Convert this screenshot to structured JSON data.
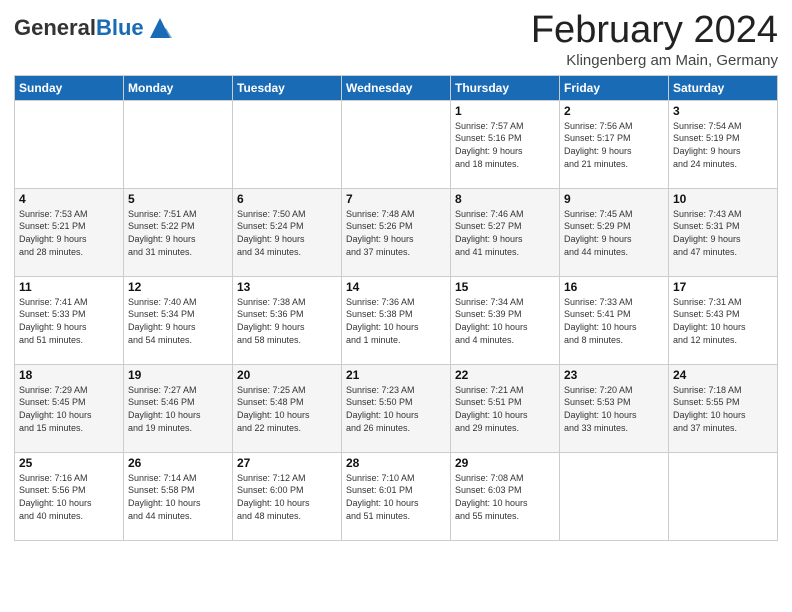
{
  "header": {
    "logo_general": "General",
    "logo_blue": "Blue",
    "title": "February 2024",
    "subtitle": "Klingenberg am Main, Germany"
  },
  "days_of_week": [
    "Sunday",
    "Monday",
    "Tuesday",
    "Wednesday",
    "Thursday",
    "Friday",
    "Saturday"
  ],
  "weeks": [
    [
      {
        "day": "",
        "info": ""
      },
      {
        "day": "",
        "info": ""
      },
      {
        "day": "",
        "info": ""
      },
      {
        "day": "",
        "info": ""
      },
      {
        "day": "1",
        "info": "Sunrise: 7:57 AM\nSunset: 5:16 PM\nDaylight: 9 hours\nand 18 minutes."
      },
      {
        "day": "2",
        "info": "Sunrise: 7:56 AM\nSunset: 5:17 PM\nDaylight: 9 hours\nand 21 minutes."
      },
      {
        "day": "3",
        "info": "Sunrise: 7:54 AM\nSunset: 5:19 PM\nDaylight: 9 hours\nand 24 minutes."
      }
    ],
    [
      {
        "day": "4",
        "info": "Sunrise: 7:53 AM\nSunset: 5:21 PM\nDaylight: 9 hours\nand 28 minutes."
      },
      {
        "day": "5",
        "info": "Sunrise: 7:51 AM\nSunset: 5:22 PM\nDaylight: 9 hours\nand 31 minutes."
      },
      {
        "day": "6",
        "info": "Sunrise: 7:50 AM\nSunset: 5:24 PM\nDaylight: 9 hours\nand 34 minutes."
      },
      {
        "day": "7",
        "info": "Sunrise: 7:48 AM\nSunset: 5:26 PM\nDaylight: 9 hours\nand 37 minutes."
      },
      {
        "day": "8",
        "info": "Sunrise: 7:46 AM\nSunset: 5:27 PM\nDaylight: 9 hours\nand 41 minutes."
      },
      {
        "day": "9",
        "info": "Sunrise: 7:45 AM\nSunset: 5:29 PM\nDaylight: 9 hours\nand 44 minutes."
      },
      {
        "day": "10",
        "info": "Sunrise: 7:43 AM\nSunset: 5:31 PM\nDaylight: 9 hours\nand 47 minutes."
      }
    ],
    [
      {
        "day": "11",
        "info": "Sunrise: 7:41 AM\nSunset: 5:33 PM\nDaylight: 9 hours\nand 51 minutes."
      },
      {
        "day": "12",
        "info": "Sunrise: 7:40 AM\nSunset: 5:34 PM\nDaylight: 9 hours\nand 54 minutes."
      },
      {
        "day": "13",
        "info": "Sunrise: 7:38 AM\nSunset: 5:36 PM\nDaylight: 9 hours\nand 58 minutes."
      },
      {
        "day": "14",
        "info": "Sunrise: 7:36 AM\nSunset: 5:38 PM\nDaylight: 10 hours\nand 1 minute."
      },
      {
        "day": "15",
        "info": "Sunrise: 7:34 AM\nSunset: 5:39 PM\nDaylight: 10 hours\nand 4 minutes."
      },
      {
        "day": "16",
        "info": "Sunrise: 7:33 AM\nSunset: 5:41 PM\nDaylight: 10 hours\nand 8 minutes."
      },
      {
        "day": "17",
        "info": "Sunrise: 7:31 AM\nSunset: 5:43 PM\nDaylight: 10 hours\nand 12 minutes."
      }
    ],
    [
      {
        "day": "18",
        "info": "Sunrise: 7:29 AM\nSunset: 5:45 PM\nDaylight: 10 hours\nand 15 minutes."
      },
      {
        "day": "19",
        "info": "Sunrise: 7:27 AM\nSunset: 5:46 PM\nDaylight: 10 hours\nand 19 minutes."
      },
      {
        "day": "20",
        "info": "Sunrise: 7:25 AM\nSunset: 5:48 PM\nDaylight: 10 hours\nand 22 minutes."
      },
      {
        "day": "21",
        "info": "Sunrise: 7:23 AM\nSunset: 5:50 PM\nDaylight: 10 hours\nand 26 minutes."
      },
      {
        "day": "22",
        "info": "Sunrise: 7:21 AM\nSunset: 5:51 PM\nDaylight: 10 hours\nand 29 minutes."
      },
      {
        "day": "23",
        "info": "Sunrise: 7:20 AM\nSunset: 5:53 PM\nDaylight: 10 hours\nand 33 minutes."
      },
      {
        "day": "24",
        "info": "Sunrise: 7:18 AM\nSunset: 5:55 PM\nDaylight: 10 hours\nand 37 minutes."
      }
    ],
    [
      {
        "day": "25",
        "info": "Sunrise: 7:16 AM\nSunset: 5:56 PM\nDaylight: 10 hours\nand 40 minutes."
      },
      {
        "day": "26",
        "info": "Sunrise: 7:14 AM\nSunset: 5:58 PM\nDaylight: 10 hours\nand 44 minutes."
      },
      {
        "day": "27",
        "info": "Sunrise: 7:12 AM\nSunset: 6:00 PM\nDaylight: 10 hours\nand 48 minutes."
      },
      {
        "day": "28",
        "info": "Sunrise: 7:10 AM\nSunset: 6:01 PM\nDaylight: 10 hours\nand 51 minutes."
      },
      {
        "day": "29",
        "info": "Sunrise: 7:08 AM\nSunset: 6:03 PM\nDaylight: 10 hours\nand 55 minutes."
      },
      {
        "day": "",
        "info": ""
      },
      {
        "day": "",
        "info": ""
      }
    ]
  ]
}
